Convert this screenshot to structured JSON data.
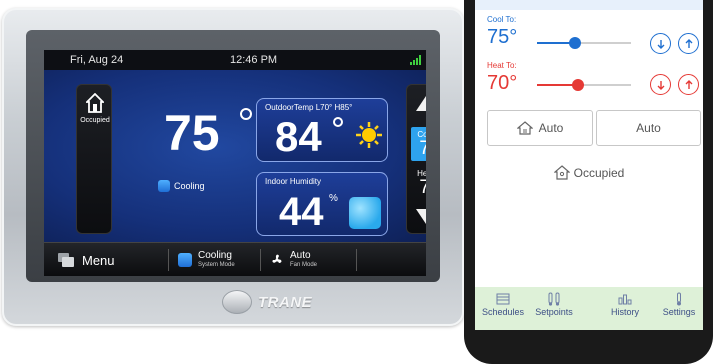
{
  "thermostat": {
    "status_bar": {
      "date": "Fri, Aug 24",
      "time": "12:46 PM",
      "signal_icon": "signal-icon"
    },
    "occupied_label": "Occupied",
    "indoor_temp": "75",
    "mode_label": "Cooling",
    "outdoor": {
      "title": "OutdoorTemp L70° H85°",
      "temp": "84",
      "icon": "sun-icon"
    },
    "humidity": {
      "title": "Indoor Humidity",
      "value": "44",
      "unit": "%"
    },
    "setpoints": {
      "cool_label": "Cool to",
      "cool_value": "75",
      "heat_label": "Heat to",
      "heat_value": "70"
    },
    "bottom_bar": {
      "menu_label": "Menu",
      "system_mode_label": "Cooling",
      "system_mode_sub": "System Mode",
      "fan_mode_label": "Auto",
      "fan_mode_sub": "Fan Mode"
    },
    "brand": "TRANE"
  },
  "app": {
    "cool": {
      "label": "Cool To:",
      "value": "75°",
      "slider_fraction": 0.4,
      "color": "#1e6fd0"
    },
    "heat": {
      "label": "Heat To:",
      "value": "70°",
      "slider_fraction": 0.44,
      "color": "#e53935"
    },
    "system_mode_button": "Auto",
    "fan_mode_button": "Auto",
    "occupied_label": "Occupied",
    "nav": [
      {
        "label": "Schedules",
        "icon": "schedules-icon"
      },
      {
        "label": "Setpoints",
        "icon": "setpoints-icon"
      },
      {
        "label": "History",
        "icon": "history-icon"
      },
      {
        "label": "Settings",
        "icon": "settings-icon"
      }
    ]
  }
}
